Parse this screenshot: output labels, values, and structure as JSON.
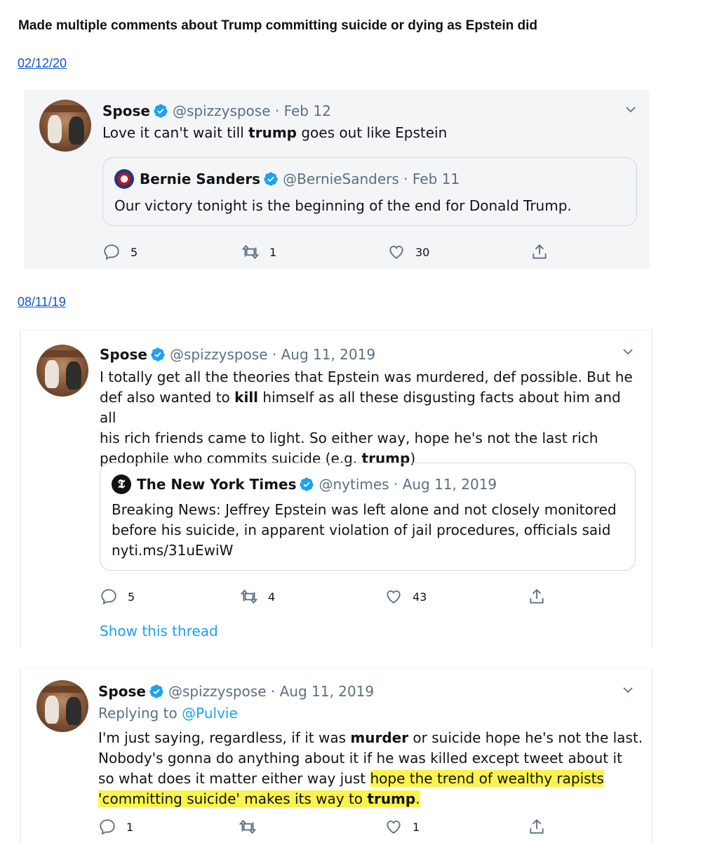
{
  "heading": "Made multiple comments about Trump committing suicide or dying as Epstein did",
  "tweets": [
    {
      "date_link": "02/12/20",
      "name": "Spose",
      "meta": "@spizzyspose · Feb 12",
      "text": [
        "Love it can't wait till ",
        "trump",
        " goes out like Epstein"
      ],
      "quote": {
        "name": "Bernie Sanders",
        "meta": "@BernieSanders · Feb 11",
        "text": "Our victory tonight is the beginning of the end for Donald Trump."
      },
      "replies": "5",
      "retweets": "1",
      "likes": "30"
    },
    {
      "date_link": "08/11/19",
      "name": "Spose",
      "meta": "@spizzyspose · Aug 11, 2019",
      "text_lines": [
        [
          "I totally get all the theories that Epstein was murdered, def possible. But he"
        ],
        [
          "def also wanted to ",
          "kill",
          " himself as all these disgusting facts about him and all"
        ],
        [
          "his rich friends came to light. So either way, hope he's not the last rich"
        ],
        [
          "pedophile who commits suicide (e.g. ",
          "trump",
          ")"
        ]
      ],
      "quote": {
        "name": "The New York Times",
        "meta": "@nytimes · Aug 11, 2019",
        "text_lines": [
          "Breaking News: Jeffrey Epstein was left alone and not closely monitored",
          "before his suicide, in apparent violation of jail procedures, officials said",
          "nyti.ms/31uEwiW"
        ]
      },
      "replies": "5",
      "retweets": "4",
      "likes": "43",
      "show_thread": "Show this thread"
    },
    {
      "name": "Spose",
      "meta": "@spizzyspose · Aug 11, 2019",
      "replying_prefix": "Replying to ",
      "replying_mention": "@Pulvie",
      "line1_a": "I'm just saying, regardless, if it was ",
      "line1_b": "murder",
      "line1_c": " or suicide hope he's not the last.",
      "line2": "Nobody's gonna do anything about it if he was killed except tweet about it",
      "line3_a": "so what does it matter either way just ",
      "line3_hl": "hope the trend of wealthy rapists",
      "line4_hl_a": "'committing suicide' makes its way to ",
      "line4_hl_b": "trump",
      "line4_hl_c": ".",
      "replies": "1",
      "retweets": "",
      "likes": "1"
    }
  ],
  "colors": {
    "link": "#1155cc",
    "twitter_blue": "#1da1f2",
    "highlight": "#fbf34b",
    "muted": "#5b7083"
  }
}
